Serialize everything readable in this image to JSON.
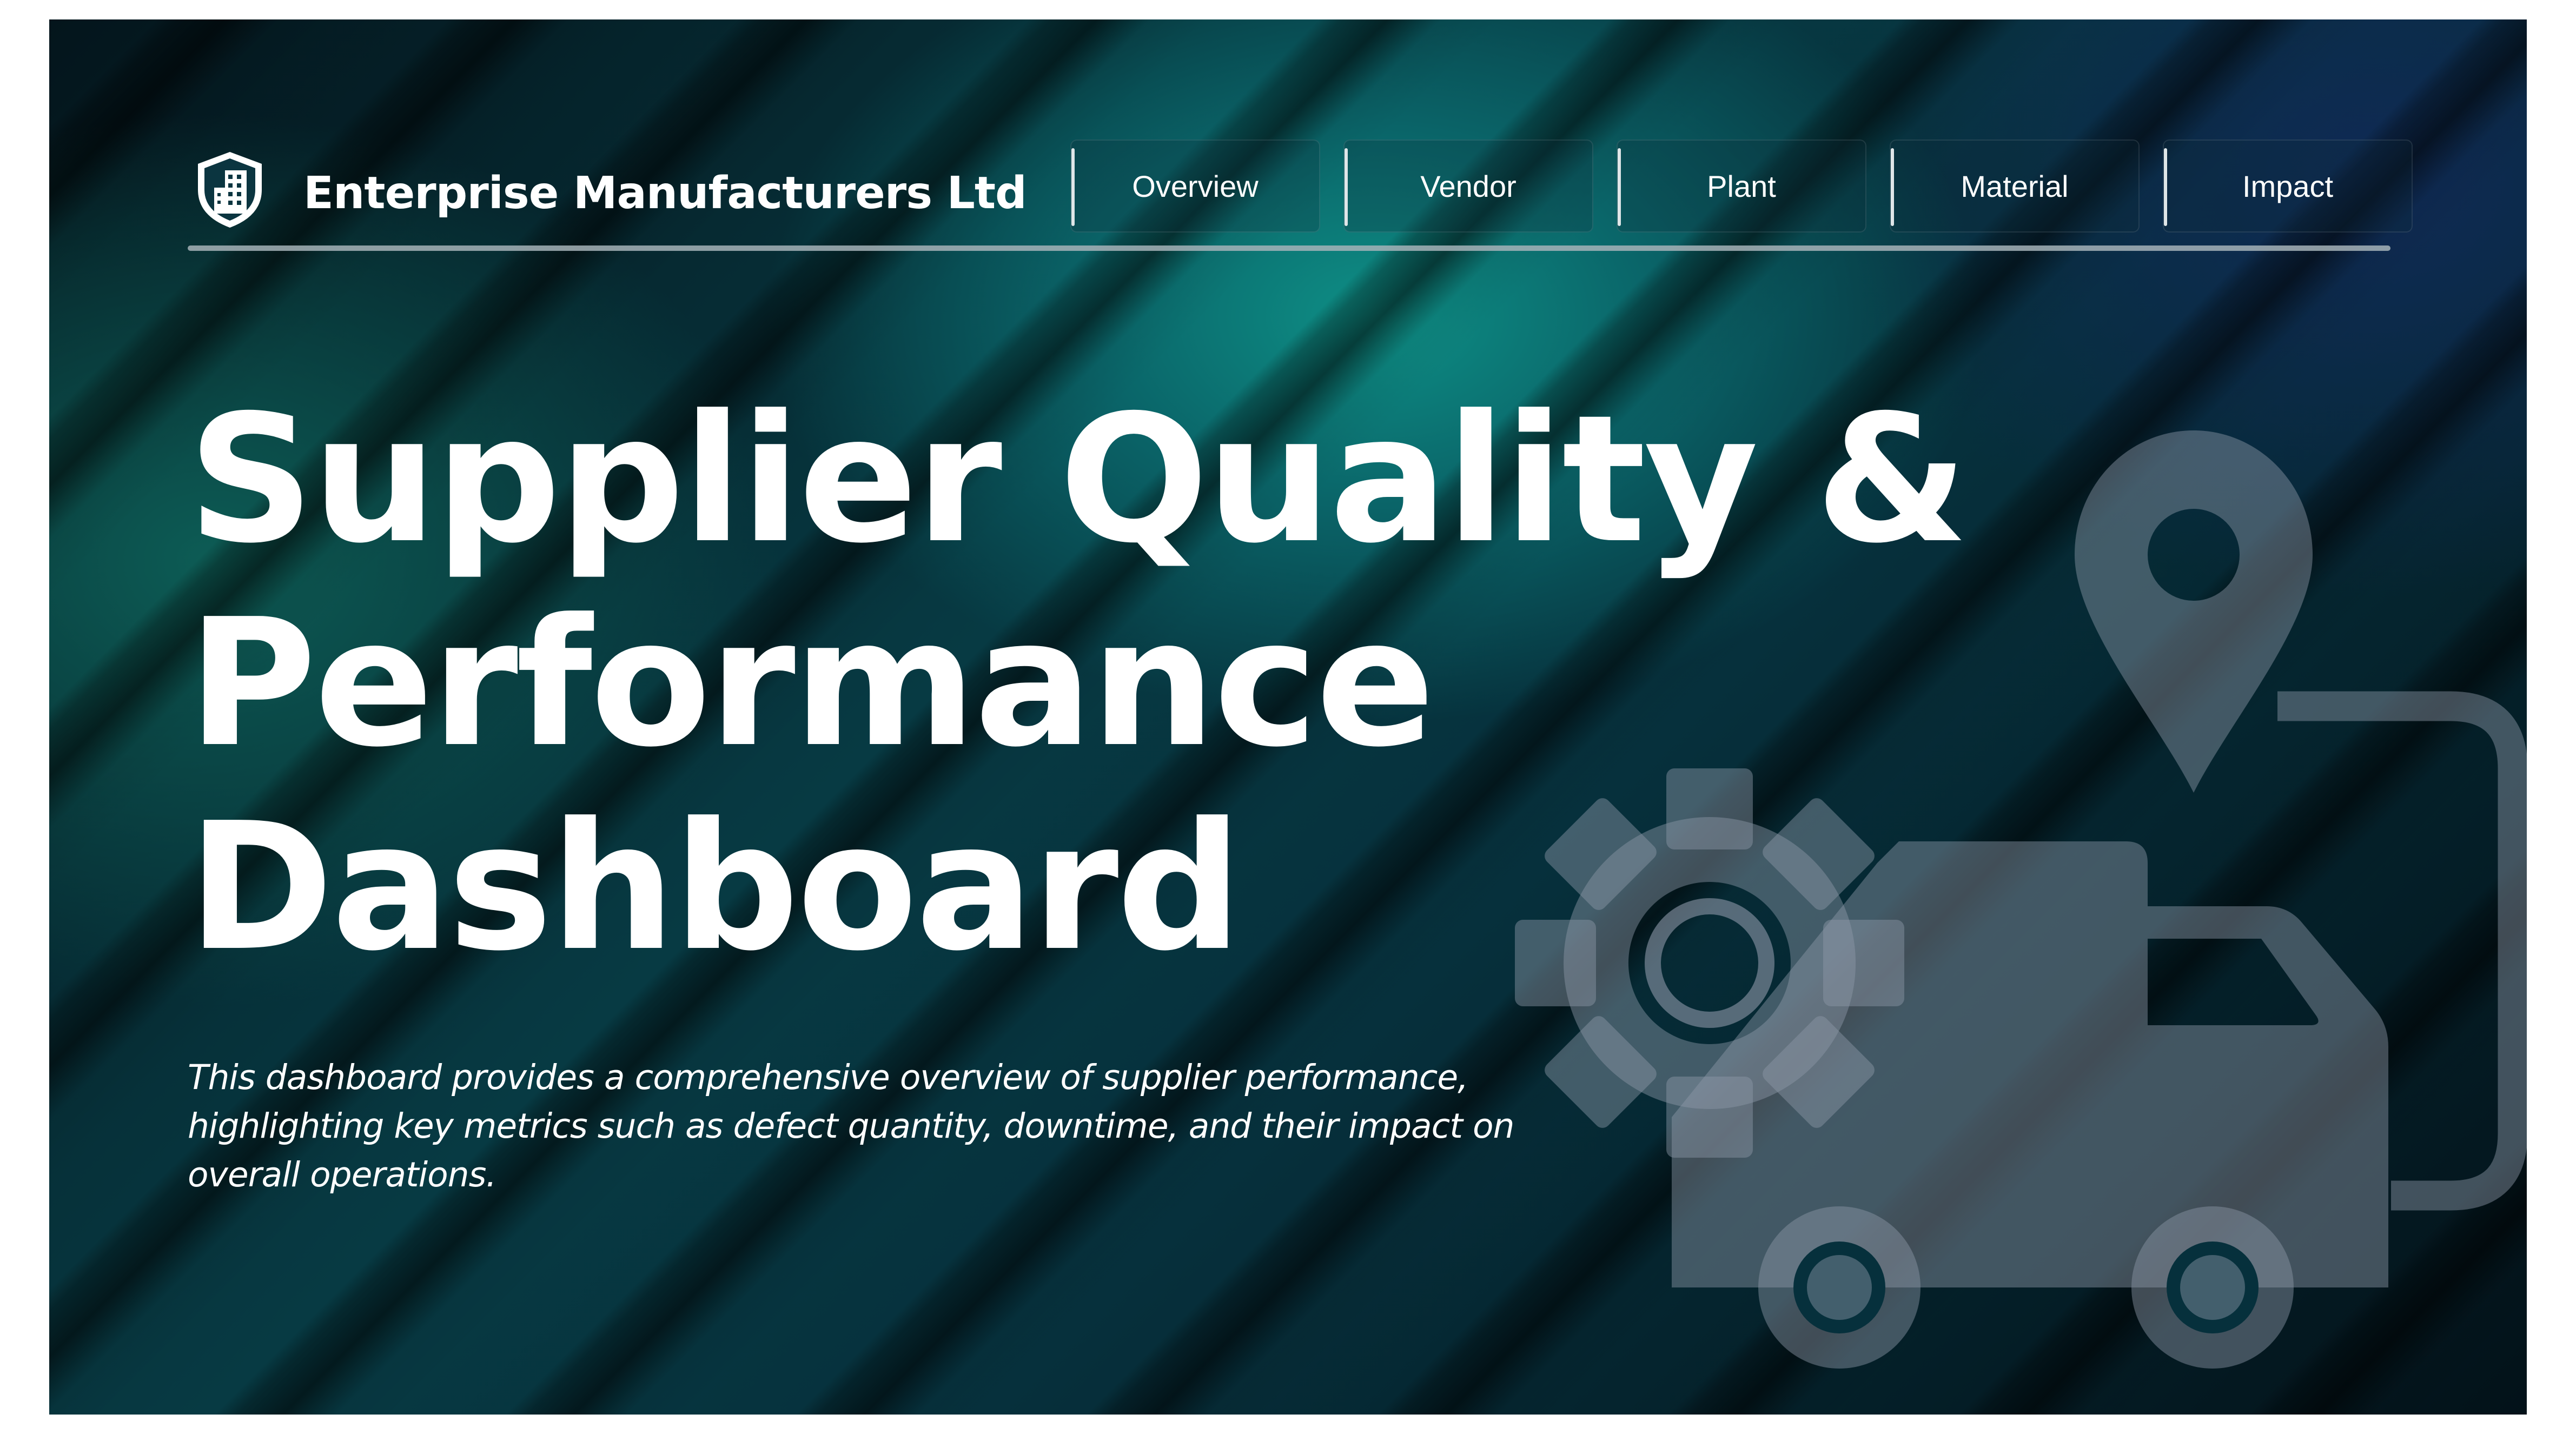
{
  "header": {
    "company_name": "Enterprise Manufacturers Ltd",
    "logo_icon": "shield-building-icon"
  },
  "nav": {
    "items": [
      {
        "label": "Overview"
      },
      {
        "label": "Vendor"
      },
      {
        "label": "Plant"
      },
      {
        "label": "Material"
      },
      {
        "label": "Impact"
      }
    ]
  },
  "hero": {
    "title_lines": [
      "Supplier Quality &",
      "Performance",
      "Dashboard"
    ],
    "description_lines": [
      "This dashboard provides a comprehensive overview of supplier performance,",
      "highlighting key metrics such as defect quantity, downtime, and their impact on",
      "overall operations."
    ],
    "illustration_icons": [
      "location-pin-icon",
      "gear-icon",
      "delivery-truck-icon"
    ]
  },
  "colors": {
    "background_dark": "#04151c",
    "background_teal": "#0e8f86",
    "text": "#ffffff",
    "illustration": "#8a96a6"
  }
}
